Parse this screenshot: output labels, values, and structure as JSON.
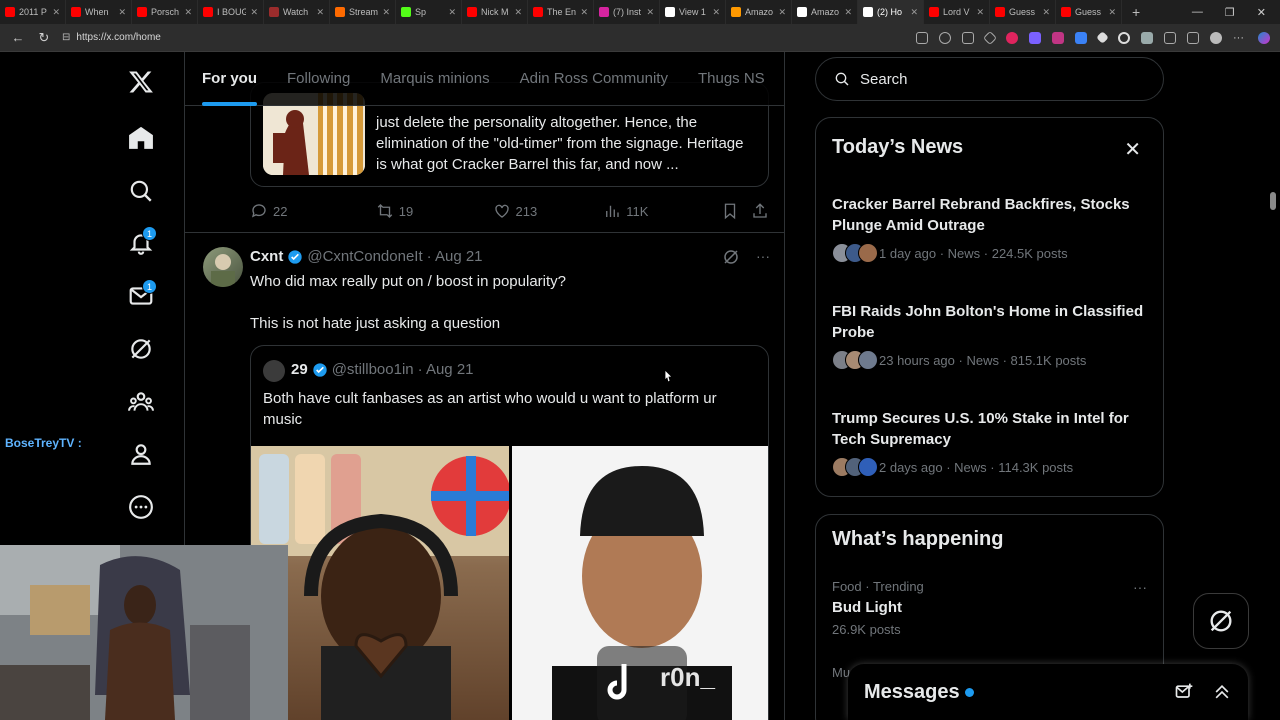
{
  "browser": {
    "tabs": [
      {
        "label": "2011 P",
        "color": "#ff0000"
      },
      {
        "label": "When",
        "color": "#ff0000"
      },
      {
        "label": "Porsch",
        "color": "#ff0000"
      },
      {
        "label": "I BOUG",
        "color": "#ff0000"
      },
      {
        "label": "Watch",
        "color": "#9b2c2c"
      },
      {
        "label": "Stream",
        "color": "#ff6a00"
      },
      {
        "label": "Sp",
        "color": "#53fc18"
      },
      {
        "label": "Nick M",
        "color": "#ff0000"
      },
      {
        "label": "The En",
        "color": "#ff0000"
      },
      {
        "label": "(7) Inst",
        "color": "#d6249f"
      },
      {
        "label": "View 1",
        "color": "#ffffff"
      },
      {
        "label": "Amazo",
        "color": "#ff9900"
      },
      {
        "label": "Amazo",
        "color": "#ffffff"
      },
      {
        "label": "(2) Ho",
        "color": "#ffffff",
        "active": true
      },
      {
        "label": "Lord V",
        "color": "#ff0000"
      },
      {
        "label": "Guess",
        "color": "#ff0000"
      },
      {
        "label": "Guess",
        "color": "#ff0000"
      }
    ],
    "url": "https://x.com/home",
    "newtab": "+"
  },
  "nav": {
    "notifications_badge": "1",
    "messages_badge": "1"
  },
  "feed": {
    "tabs": [
      "For you",
      "Following",
      "Marquis minions",
      "Adin Ross Community",
      "Thugs NS"
    ],
    "top_card_text": "just delete the personality altogether. Hence, the elimination of the \"old-timer\" from the signage. Heritage is what got Cracker Barrel this far, and now ...",
    "actions": {
      "replies": "22",
      "reposts": "19",
      "likes": "213",
      "views": "11K"
    },
    "post": {
      "name": "Cxnt",
      "handle": "@CxntCondoneIt",
      "date": "· Aug 21",
      "text1": "Who did max really put on / boost in popularity?",
      "text2": "This is not hate just asking a question",
      "quote": {
        "name": "29",
        "handle": "@stillboo1in",
        "date": "· Aug 21",
        "text": "Both have cult fanbases as an artist who would u want to platform ur music",
        "watermark": "r0n_"
      }
    }
  },
  "sidebar": {
    "search_placeholder": "Search",
    "news": {
      "title": "Today’s News",
      "items": [
        {
          "title": "Cracker Barrel Rebrand Backfires, Stocks Plunge Amid Outrage",
          "meta": "1 day ago · News · 224.5K posts"
        },
        {
          "title": "FBI Raids John Bolton's Home in Classified Probe",
          "meta": "23 hours ago · News · 815.1K posts"
        },
        {
          "title": "Trump Secures U.S. 10% Stake in Intel for Tech Supremacy",
          "meta": "2 days ago · News · 114.3K posts"
        }
      ]
    },
    "happening": {
      "title": "What’s happening",
      "trend": {
        "category": "Food · Trending",
        "name": "Bud Light",
        "count": "26.9K posts"
      },
      "cut_label": "Mu"
    }
  },
  "messages": {
    "title": "Messages"
  },
  "overlay": {
    "streamer": "BoseTreyTV :"
  },
  "colors": {
    "accent": "#1d9bf0",
    "border": "#2f3336",
    "muted": "#71767b"
  }
}
